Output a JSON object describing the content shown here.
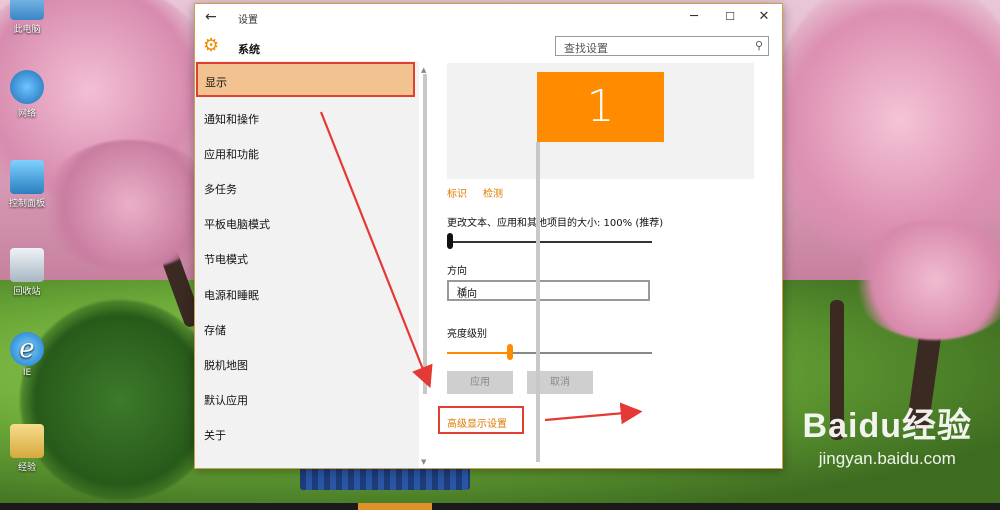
{
  "window": {
    "title": "设置",
    "header_label": "系统",
    "search_placeholder": "查找设置",
    "controls": {
      "minimize": "─",
      "maximize": "☐",
      "close": "✕",
      "back": "←"
    }
  },
  "nav": {
    "items": [
      {
        "label": "显示"
      },
      {
        "label": "通知和操作"
      },
      {
        "label": "应用和功能"
      },
      {
        "label": "多任务"
      },
      {
        "label": "平板电脑模式"
      },
      {
        "label": "节电模式"
      },
      {
        "label": "电源和睡眠"
      },
      {
        "label": "存储"
      },
      {
        "label": "脱机地图"
      },
      {
        "label": "默认应用"
      },
      {
        "label": "关于"
      }
    ],
    "selected_index": 0
  },
  "display": {
    "monitor_number": "1",
    "identify_link": "标识",
    "detect_link": "检测",
    "scale_label": "更改文本、应用和其他项目的大小: 100% (推荐)",
    "scale_slider_value": 0.0,
    "orientation_label": "方向",
    "orientation_value": "横向",
    "brightness_label": "亮度级别",
    "brightness_slider_value": 0.3,
    "apply_button": "应用",
    "cancel_button": "取消",
    "advanced_link": "高级显示设置"
  },
  "desktop": {
    "icons": [
      {
        "label": "此电脑"
      },
      {
        "label": "网络"
      },
      {
        "label": "控制面板"
      },
      {
        "label": "回收站"
      },
      {
        "label": "IE"
      },
      {
        "label": "经验"
      }
    ]
  },
  "watermark": {
    "brand": "Baidu经验",
    "url": "jingyan.baidu.com"
  },
  "colors": {
    "accent": "#FF8C00",
    "highlight": "#E04030",
    "selection": "#F2C290"
  }
}
